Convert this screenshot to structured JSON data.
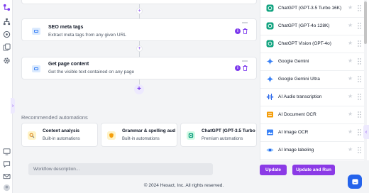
{
  "workflow": {
    "cards": [
      {
        "title": "SEO meta tags",
        "description": "Extract meta tags from any given URL"
      },
      {
        "title": "Get page content",
        "description": "Get the visible text contained on any page"
      }
    ],
    "info_badge": "i"
  },
  "recommended": {
    "title": "Recommended automations",
    "items": [
      {
        "name": "Content analysis",
        "subtitle": "Built-in automations",
        "icon": "magnify-icon"
      },
      {
        "name": "Grammar & spelling aud",
        "subtitle": "Built-in automations",
        "icon": "grammar-shield-icon"
      },
      {
        "name": "ChatGPT (GPT-3.5 Turbo",
        "subtitle": "Premium automations",
        "icon": "chatgpt-icon"
      }
    ]
  },
  "models": [
    {
      "name": "ChatGPT (GPT-3.5 Turbo 16K)",
      "icon": "chatgpt-icon"
    },
    {
      "name": "ChatGPT (GPT-4o 128K)",
      "icon": "chatgpt-icon"
    },
    {
      "name": "ChatGPT Vision (GPT-4o)",
      "icon": "chatgpt-icon"
    },
    {
      "name": "Google Gemini",
      "icon": "gemini-icon"
    },
    {
      "name": "Google Gemini Ultra",
      "icon": "gemini-icon"
    },
    {
      "name": "AI Audio transcription",
      "icon": "audio-wave-icon"
    },
    {
      "name": "AI Document OCR",
      "icon": "document-ocr-icon"
    },
    {
      "name": "AI Image OCR",
      "icon": "image-ocr-icon"
    },
    {
      "name": "AI Image labeling",
      "icon": "eye-icon"
    }
  ],
  "bottom": {
    "description_placeholder": "Workflow description...",
    "update_label": "Update",
    "update_run_label": "Update and Run"
  },
  "footer": "© 2024 Hexact, Inc. All rights reserved.",
  "colors": {
    "accent": "#8b3ae6",
    "chat": "#2563eb"
  }
}
